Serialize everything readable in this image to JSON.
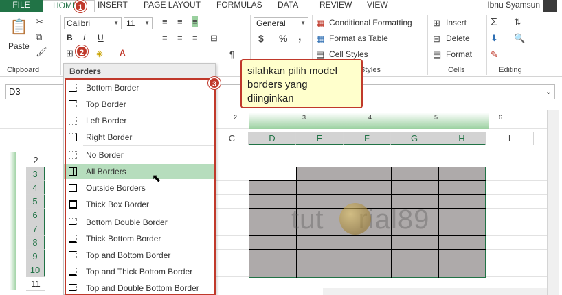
{
  "tabs": {
    "file": "FILE",
    "home": "HOME",
    "insert": "INSERT",
    "page_layout": "PAGE LAYOUT",
    "formulas": "FORMULAS",
    "data": "DATA",
    "review": "REVIEW",
    "view": "VIEW"
  },
  "user_name": "Ibnu Syamsun",
  "ribbon": {
    "clipboard": {
      "paste": "Paste",
      "label": "Clipboard"
    },
    "font": {
      "name": "Calibri",
      "size": "11",
      "bold": "B",
      "italic": "I",
      "underline": "U",
      "font_color": "A"
    },
    "number": {
      "format": "General",
      "currency": "$",
      "percent": "%",
      "comma": ","
    },
    "styles": {
      "conditional": "Conditional Formatting",
      "format_table": "Format as Table",
      "cell_styles": "Cell Styles",
      "label": "Styles"
    },
    "cells": {
      "insert": "Insert",
      "delete": "Delete",
      "format": "Format",
      "label": "Cells"
    },
    "editing": {
      "label": "Editing"
    }
  },
  "name_box": "D3",
  "ruler_numbers": [
    "2",
    "3",
    "4",
    "5",
    "6"
  ],
  "columns": [
    "C",
    "D",
    "E",
    "F",
    "G",
    "H",
    "I"
  ],
  "rows": [
    "2",
    "3",
    "4",
    "5",
    "6",
    "7",
    "8",
    "9",
    "10",
    "11"
  ],
  "borders_menu": {
    "title": "Borders",
    "items": [
      "Bottom Border",
      "Top Border",
      "Left Border",
      "Right Border",
      "No Border",
      "All Borders",
      "Outside Borders",
      "Thick Box Border",
      "Bottom Double Border",
      "Thick Bottom Border",
      "Top and Bottom Border",
      "Top and Thick Bottom Border",
      "Top and Double Bottom Border"
    ],
    "highlighted": "All Borders"
  },
  "callout_text": "silahkan pilih model borders yang diinginkan",
  "badges": [
    "2",
    "3"
  ],
  "watermark": {
    "left": "tut",
    "right": "rial89"
  },
  "colors": {
    "excel_green": "#217346",
    "highlight": "#b6ddbd",
    "annotation_red": "#c0392b"
  }
}
